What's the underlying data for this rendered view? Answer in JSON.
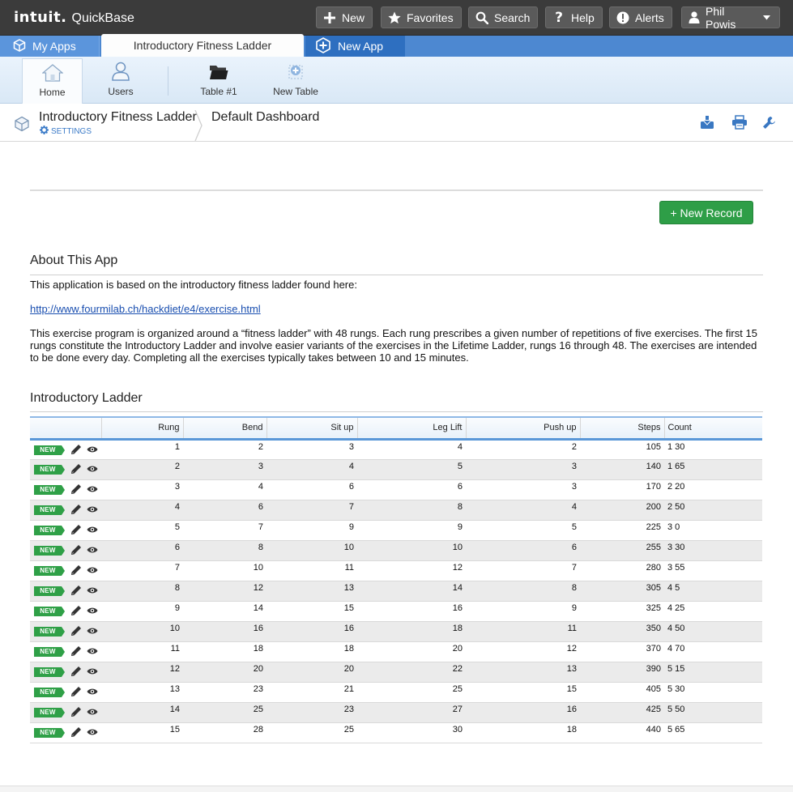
{
  "brand": {
    "logo": "intuit.",
    "product": "QuickBase"
  },
  "topnav": {
    "new": "New",
    "favorites": "Favorites",
    "search": "Search",
    "help": "Help",
    "alerts": "Alerts",
    "user": "Phil Powis"
  },
  "tabs": {
    "my_apps": "My Apps",
    "current": "Introductory Fitness Ladder",
    "new_app": "New App"
  },
  "pagebar": {
    "home": "Home",
    "users": "Users",
    "table1": "Table #1",
    "new_table": "New Table"
  },
  "breadcrumb": {
    "app": "Introductory Fitness Ladder",
    "settings": "SETTINGS",
    "page": "Default Dashboard"
  },
  "new_record_button": "+ New Record",
  "about": {
    "title": "About This App",
    "intro": "This application is based on the introductory fitness ladder found here:",
    "link": "http://www.fourmilab.ch/hackdiet/e4/exercise.html",
    "body": "This exercise program is organized around a “fitness ladder” with 48 rungs. Each rung prescribes a given number of repetitions of five exercises. The first 15 rungs constitute the Introductory Ladder and involve easier variants of the exercises in the Lifetime Ladder, rungs 16 through 48. The exercises are intended to be done every day. Completing all the exercises typically takes between 10 and 15 minutes."
  },
  "ladder": {
    "title": "Introductory Ladder",
    "new_tag": "NEW",
    "columns": [
      "Rung",
      "Bend",
      "Sit up",
      "Leg Lift",
      "Push up",
      "Steps",
      "Count"
    ],
    "rows": [
      [
        "1",
        "2",
        "3",
        "4",
        "2",
        "105",
        "1 30"
      ],
      [
        "2",
        "3",
        "4",
        "5",
        "3",
        "140",
        "1 65"
      ],
      [
        "3",
        "4",
        "6",
        "6",
        "3",
        "170",
        "2 20"
      ],
      [
        "4",
        "6",
        "7",
        "8",
        "4",
        "200",
        "2 50"
      ],
      [
        "5",
        "7",
        "9",
        "9",
        "5",
        "225",
        "3 0"
      ],
      [
        "6",
        "8",
        "10",
        "10",
        "6",
        "255",
        "3 30"
      ],
      [
        "7",
        "10",
        "11",
        "12",
        "7",
        "280",
        "3 55"
      ],
      [
        "8",
        "12",
        "13",
        "14",
        "8",
        "305",
        "4 5"
      ],
      [
        "9",
        "14",
        "15",
        "16",
        "9",
        "325",
        "4 25"
      ],
      [
        "10",
        "16",
        "16",
        "18",
        "11",
        "350",
        "4 50"
      ],
      [
        "11",
        "18",
        "18",
        "20",
        "12",
        "370",
        "4 70"
      ],
      [
        "12",
        "20",
        "20",
        "22",
        "13",
        "390",
        "5 15"
      ],
      [
        "13",
        "23",
        "21",
        "25",
        "15",
        "405",
        "5 30"
      ],
      [
        "14",
        "25",
        "23",
        "27",
        "16",
        "425",
        "5 50"
      ],
      [
        "15",
        "28",
        "25",
        "30",
        "18",
        "440",
        "5 65"
      ]
    ]
  },
  "colors": {
    "topbar": "#3b3b3b",
    "tabstrip": "#4d88d1",
    "new_app_tab": "#2e6fc0",
    "new_record": "#2e9e47",
    "link": "#1a4fb0"
  }
}
